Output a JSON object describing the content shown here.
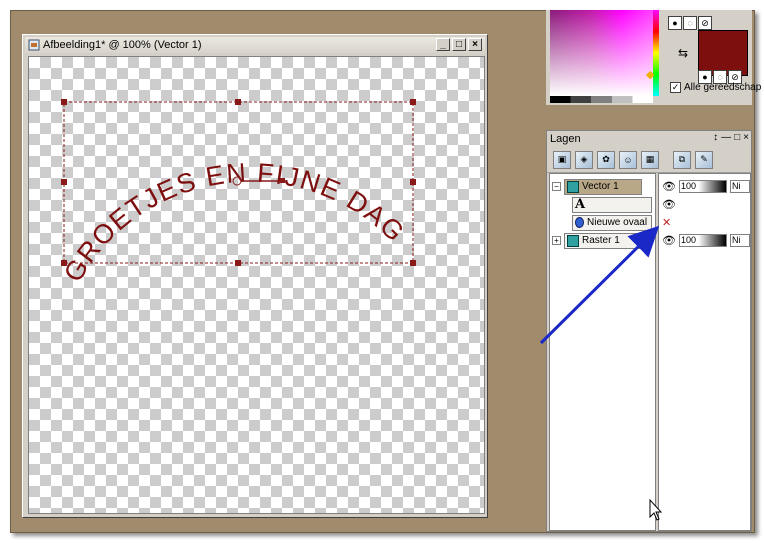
{
  "image_window": {
    "title": "Afbeelding1* @ 100% (Vector 1)",
    "minimize": "_",
    "maximize": "□",
    "close": "×"
  },
  "canvas": {
    "arc_text": "GROETJES EN FIJNE DAG",
    "text_color": "#7e0f0f"
  },
  "palette": {
    "all_tools_label": "Alle gereedschap",
    "all_tools_checked": true,
    "foreground_color": "#7e0f0f"
  },
  "layers_panel": {
    "title": "Lagen",
    "title_buttons": [
      "↕",
      "—",
      "□",
      "×"
    ],
    "toolbar_icons": [
      "new-raster-layer-icon",
      "new-vector-layer-icon",
      "new-art-media-layer-icon",
      "new-mask-layer-icon",
      "new-adjustment-layer-icon",
      "duplicate-layer-icon",
      "edit-selection-icon"
    ],
    "layers": [
      {
        "name": "Vector 1",
        "type": "vector",
        "selected": true,
        "opacity": "100",
        "blend": "Ni",
        "expanded": "−"
      },
      {
        "name": "A",
        "type": "text"
      },
      {
        "name": "Nieuwe ovaal",
        "type": "oval"
      },
      {
        "name": "Raster 1",
        "type": "raster",
        "opacity": "100",
        "blend": "Ni",
        "expanded": "+"
      }
    ]
  },
  "annotation_arrow_color": "#1a28c8"
}
